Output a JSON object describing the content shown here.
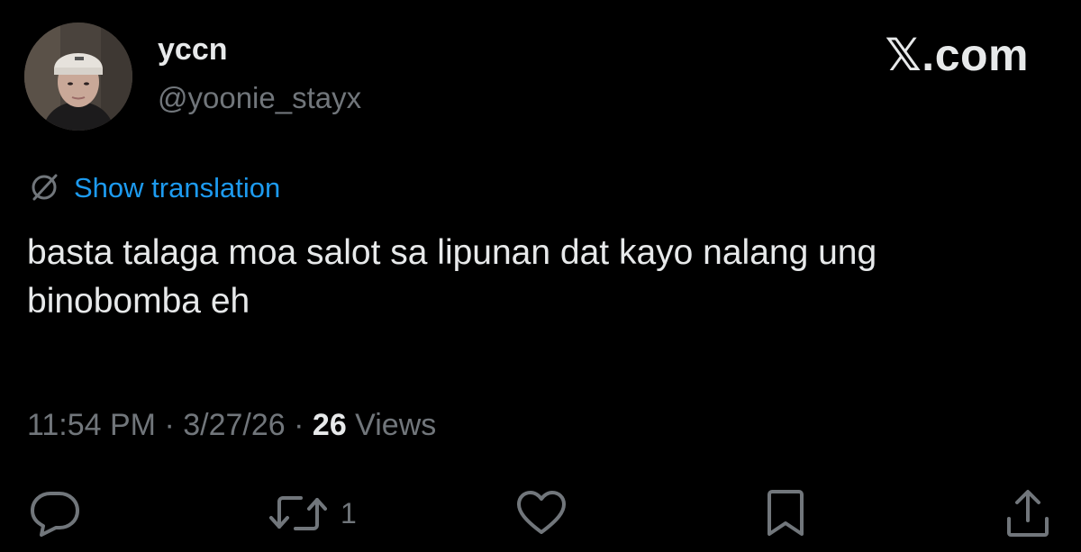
{
  "header": {
    "display_name": "yccn",
    "handle": "@yoonie_stayx",
    "brand": "𝕏.com"
  },
  "translation": {
    "label": "Show translation"
  },
  "tweet": {
    "text": "basta talaga moa salot sa lipunan dat kayo nalang ung binobomba eh"
  },
  "meta": {
    "time": "11:54 PM",
    "separator": " · ",
    "date": "3/27/26",
    "views_count": "26",
    "views_label": " Views"
  },
  "actions": {
    "reply_icon": "reply-icon",
    "retweet_icon": "retweet-icon",
    "retweet_count": "1",
    "like_icon": "heart-icon",
    "bookmark_icon": "bookmark-icon",
    "share_icon": "share-icon"
  },
  "colors": {
    "background": "#000000",
    "text": "#e7e9ea",
    "muted": "#71767b",
    "link": "#1d9bf0"
  }
}
